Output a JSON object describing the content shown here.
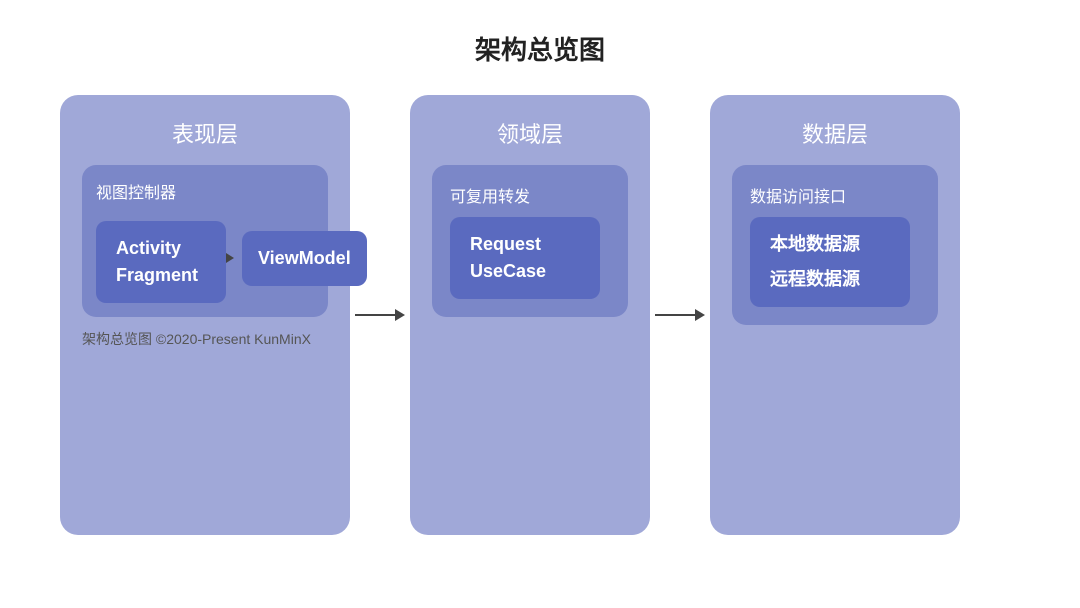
{
  "page": {
    "title": "架构总览图"
  },
  "presentation": {
    "layer_title": "表现层",
    "inner_title": "视图控制器",
    "activity_label": "Activity",
    "fragment_label": "Fragment",
    "viewmodel_label": "ViewModel"
  },
  "domain": {
    "layer_title": "领域层",
    "inner_title": "可复用转发",
    "request_label": "Request",
    "usecase_label": "UseCase"
  },
  "data": {
    "layer_title": "数据层",
    "inner_title": "数据访问接口",
    "local_label": "本地数据源",
    "remote_label": "远程数据源"
  },
  "copyright": "架构总览图 ©2020-Present KunMinX",
  "colors": {
    "panel_bg": "#a0a8d8",
    "inner_bg": "#7b87c8",
    "box_bg": "#5a6abf",
    "text_white": "#ffffff",
    "arrow_color": "#333333"
  }
}
